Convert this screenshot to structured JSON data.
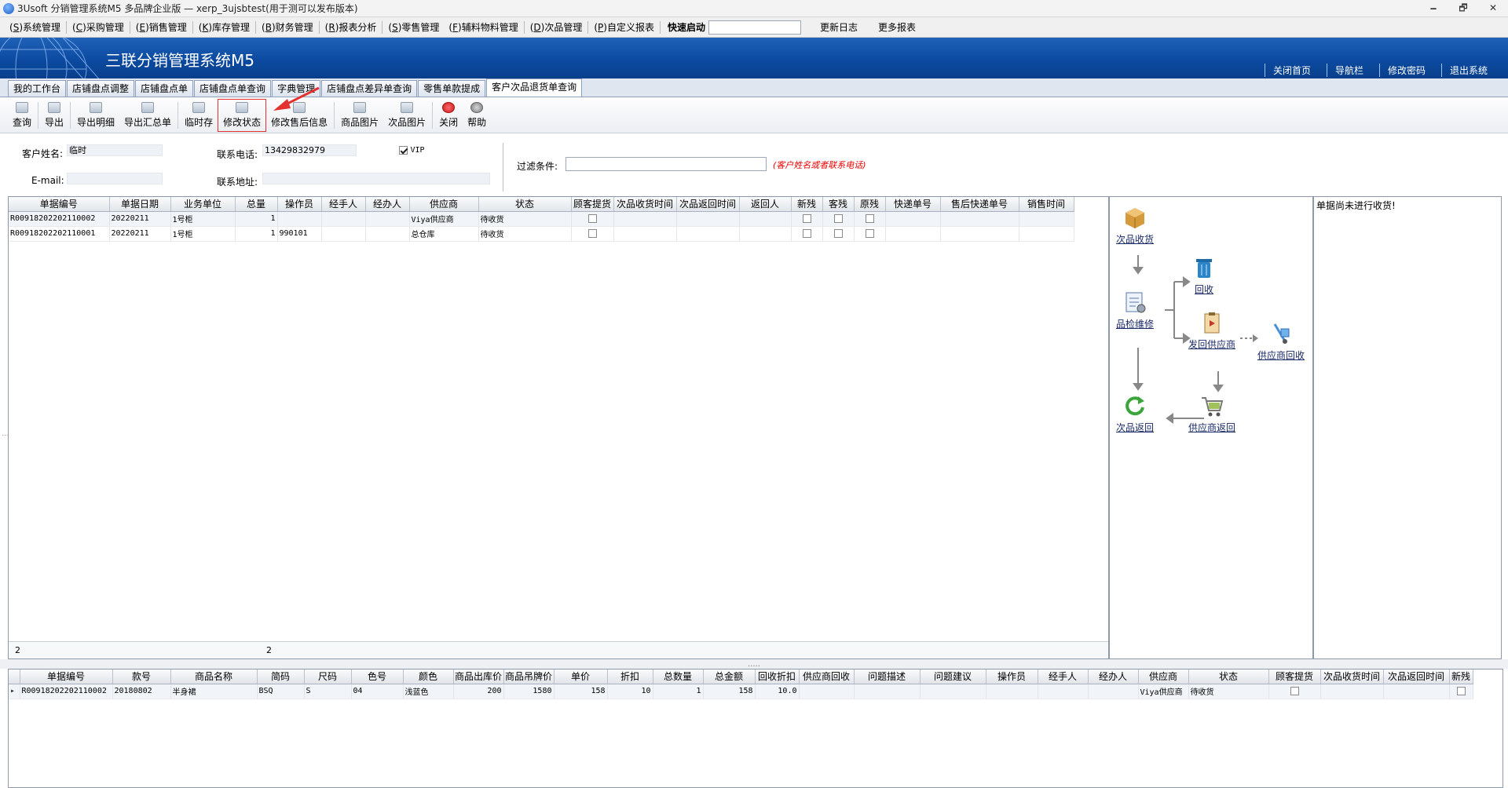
{
  "window": {
    "title": "3Usoft 分销管理系统M5 多品牌企业版 — xerp_3ujsbtest(用于测可以发布版本)",
    "minimize": "🗕",
    "restore": "🗗",
    "close": "✕"
  },
  "menu": {
    "items": [
      {
        "key": "S",
        "label": "系统管理"
      },
      {
        "key": "C",
        "label": "采购管理"
      },
      {
        "key": "E",
        "label": "销售管理"
      },
      {
        "key": "K",
        "label": "库存管理"
      },
      {
        "key": "B",
        "label": "财务管理"
      },
      {
        "key": "R",
        "label": "报表分析"
      },
      {
        "key": "S",
        "label": "零售管理"
      },
      {
        "key": "F",
        "label": "辅料物料管理"
      },
      {
        "key": "D",
        "label": "次品管理"
      },
      {
        "key": "P",
        "label": "自定义报表"
      }
    ],
    "quick_label": "快速启动",
    "quick_value": "",
    "changelog": "更新日志",
    "more_reports": "更多报表"
  },
  "banner": {
    "brand": "三联分销管理系统M5",
    "links": [
      "关闭首页",
      "导航栏",
      "修改密码",
      "退出系统"
    ]
  },
  "tabs": [
    {
      "label": "我的工作台",
      "active": false
    },
    {
      "label": "店铺盘点调整",
      "active": false
    },
    {
      "label": "店铺盘点单",
      "active": false
    },
    {
      "label": "店铺盘点单查询",
      "active": false
    },
    {
      "label": "字典管理",
      "active": false
    },
    {
      "label": "店铺盘点差异单查询",
      "active": false
    },
    {
      "label": "零售单款提成",
      "active": false
    },
    {
      "label": "客户次品退货单查询",
      "active": true
    }
  ],
  "toolbar": {
    "query": "查询",
    "export": "导出",
    "export_detail": "导出明细",
    "export_summary": "导出汇总单",
    "temp_save": "临时存",
    "modify_status": "修改状态",
    "modify_aftersale": "修改售后信息",
    "product_image": "商品图片",
    "defect_image": "次品图片",
    "close": "关闭",
    "help": "帮助"
  },
  "form": {
    "customer_name_label": "客户姓名:",
    "customer_name": "临时",
    "phone_label": "联系电话:",
    "phone": "13429832979",
    "vip_label": "VIP",
    "vip_checked": true,
    "email_label": "E-mail:",
    "email": "",
    "address_label": "联系地址:",
    "address": "",
    "filter_label": "过滤条件:",
    "filter_value": "",
    "filter_hint": "(客户姓名或者联系电话)"
  },
  "upper_grid": {
    "columns": [
      "单据编号",
      "单据日期",
      "业务单位",
      "总量",
      "操作员",
      "经手人",
      "经办人",
      "供应商",
      "状态",
      "顾客提货",
      "次品收货时间",
      "次品返回时间",
      "返回人",
      "新残",
      "客残",
      "原残",
      "快递单号",
      "售后快递单号",
      "销售时间"
    ],
    "rows": [
      {
        "no": "R00918202202110002",
        "date": "20220211",
        "unit": "1号柜",
        "qty": "1",
        "operator": "",
        "handler": "",
        "agent": "",
        "supplier": "Viya供应商",
        "status": "待收货"
      },
      {
        "no": "R00918202202110001",
        "date": "20220211",
        "unit": "1号柜",
        "qty": "1",
        "operator": "990101",
        "handler": "",
        "agent": "",
        "supplier": "总仓库",
        "status": "待收货"
      }
    ],
    "footer_count": "2",
    "footer_qty": "2"
  },
  "flow": {
    "receive": "次品收货",
    "inspect": "品检维修",
    "recycle": "回收",
    "send_supplier": "发回供应商",
    "supplier_recycle": "供应商回收",
    "return": "次品返回",
    "supplier_return": "供应商返回"
  },
  "message": "单据尚未进行收货!",
  "lower_grid": {
    "columns": [
      "单据编号",
      "款号",
      "商品名称",
      "简码",
      "尺码",
      "色号",
      "颜色",
      "商品出库价",
      "商品吊牌价",
      "单价",
      "折扣",
      "总数量",
      "总金额",
      "回收折扣",
      "供应商回收",
      "问题描述",
      "问题建议",
      "操作员",
      "经手人",
      "经办人",
      "供应商",
      "状态",
      "顾客提货",
      "次品收货时间",
      "次品返回时间",
      "新残"
    ],
    "rows": [
      {
        "no": "R00918202202110002",
        "style": "20180802",
        "name": "半身裙",
        "code": "BSQ",
        "size": "S",
        "color_no": "04",
        "color": "浅蓝色",
        "out_price": "200",
        "tag_price": "1580",
        "unit_price": "158",
        "discount": "10",
        "total_qty": "1",
        "total_amt": "158",
        "recycle_disc": "10.0",
        "supplier": "Viya供应商",
        "status": "待收货"
      }
    ]
  },
  "colors": {
    "banner": "#0b4aa0",
    "highlight_red": "#e53030",
    "hint_red": "#e00000"
  }
}
